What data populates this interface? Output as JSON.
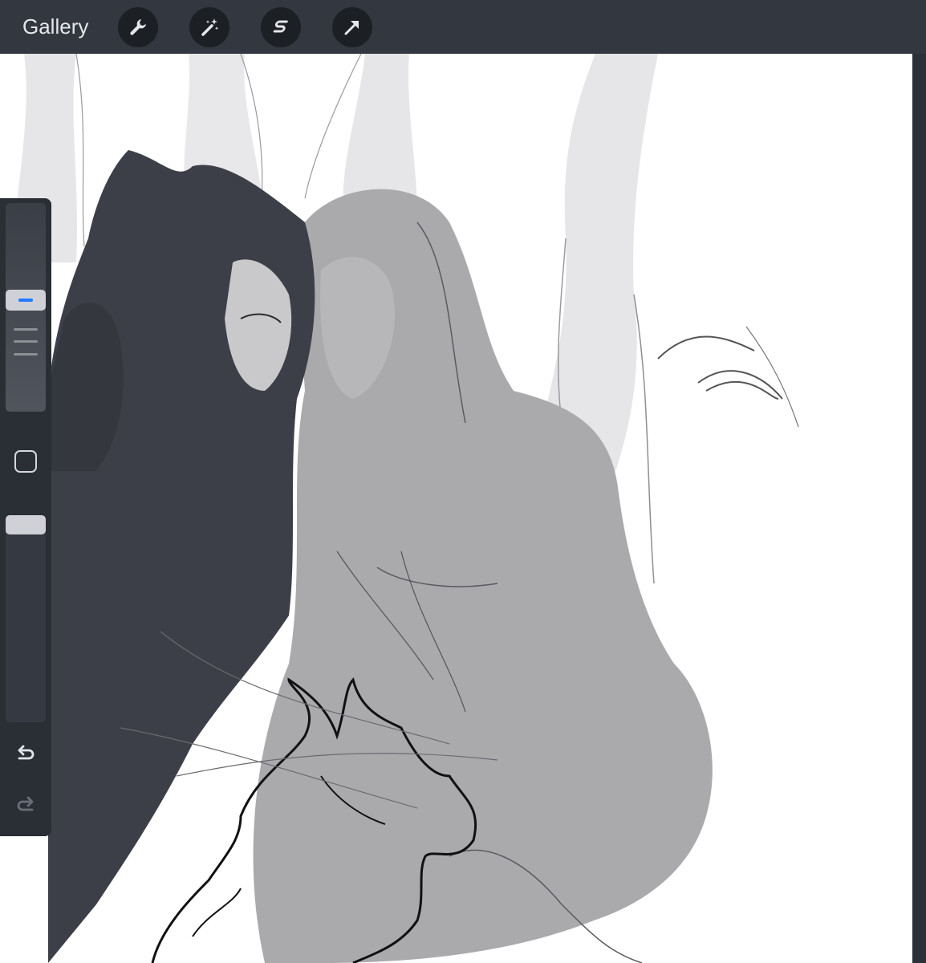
{
  "toolbar": {
    "gallery_label": "Gallery",
    "tools": [
      {
        "name": "actions",
        "icon": "wrench-icon"
      },
      {
        "name": "adjustments",
        "icon": "magic-wand-icon"
      },
      {
        "name": "selection",
        "icon": "selection-s-icon"
      },
      {
        "name": "transform",
        "icon": "arrow-cursor-icon"
      }
    ]
  },
  "sidebar": {
    "brush_size_level": 0.54,
    "opacity_level": 1.0,
    "modify_icon": "square-icon",
    "undo_icon": "undo-icon",
    "redo_icon": "redo-icon"
  },
  "colors": {
    "toolbar_bg": "#33373f",
    "sidebar_bg": "#2a2e35",
    "accent": "#1e7bff",
    "canvas_bg": "#ffffff"
  }
}
